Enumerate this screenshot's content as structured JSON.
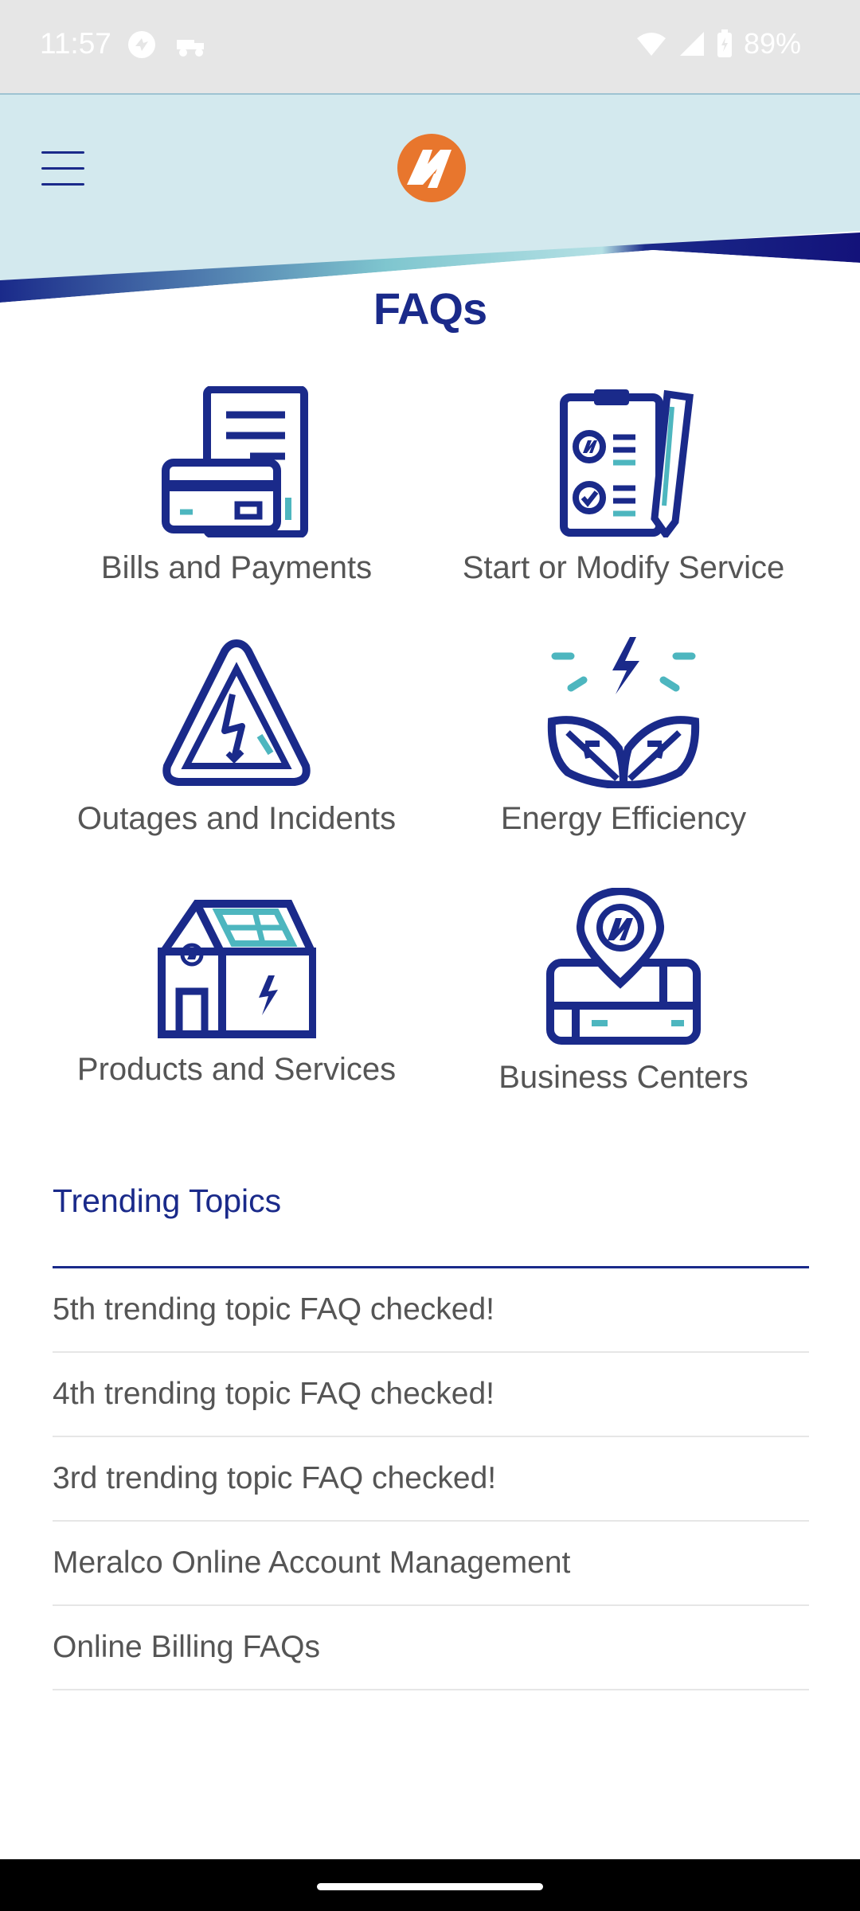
{
  "status_bar": {
    "time": "11:57",
    "battery": "89%",
    "icons": [
      "sync-icon",
      "delivery-icon",
      "wifi-icon",
      "signal-icon",
      "battery-icon"
    ]
  },
  "header": {
    "menu_icon": "hamburger-menu-icon",
    "logo_icon": "meralco-logo",
    "colors": {
      "background": "#d3e9ee",
      "brand_blue": "#1a2a8a",
      "accent_orange": "#e8762d",
      "accent_teal": "#4db6bf"
    }
  },
  "page": {
    "title": "FAQs"
  },
  "categories": [
    {
      "label": "Bills and Payments",
      "icon": "bill-card-icon"
    },
    {
      "label": "Start or Modify Service",
      "icon": "clipboard-pencil-icon"
    },
    {
      "label": "Outages and Incidents",
      "icon": "warning-bolt-icon"
    },
    {
      "label": "Energy Efficiency",
      "icon": "leaf-bolt-icon"
    },
    {
      "label": "Products and Services",
      "icon": "solar-house-icon"
    },
    {
      "label": "Business Centers",
      "icon": "map-pin-icon"
    }
  ],
  "trending": {
    "title": "Trending Topics",
    "items": [
      "5th trending topic FAQ checked!",
      "4th trending topic FAQ checked!",
      "3rd trending topic FAQ checked!",
      "Meralco Online Account Management",
      "Online Billing FAQs"
    ]
  }
}
